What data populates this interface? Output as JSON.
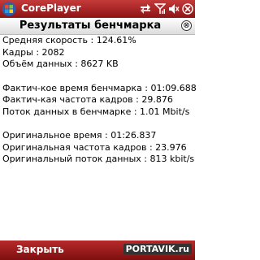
{
  "status_bar": {
    "app_title": "CorePlayer",
    "icons": [
      "start-logo-icon",
      "sync-icon",
      "signal-icon",
      "speaker-muted-icon",
      "close-icon"
    ]
  },
  "dialog": {
    "title": "Результаты бенчмарка",
    "close_glyph": "⊗"
  },
  "results": {
    "avg_speed": "Средняя скорость : 124.61%",
    "frames": "Кадры : 2082",
    "data_volume": "Объём данных : 8627 KB",
    "actual_time": "Фактич-кое время бенчмарка : 01:09.688",
    "actual_fps": "Фактич-кая частота кадров : 29.876",
    "data_rate": "Поток данных в бенчмарке : 1.01 Mbit/s",
    "original_time": "Оригинальное время : 01:26.837",
    "original_fps": "Оригинальная частота кадров : 23.976",
    "original_rate": "Оригинальный поток данных : 813 kbit/s"
  },
  "bottom_bar": {
    "left_softkey": "Закрыть",
    "watermark": "PORTAVIK.ru"
  }
}
